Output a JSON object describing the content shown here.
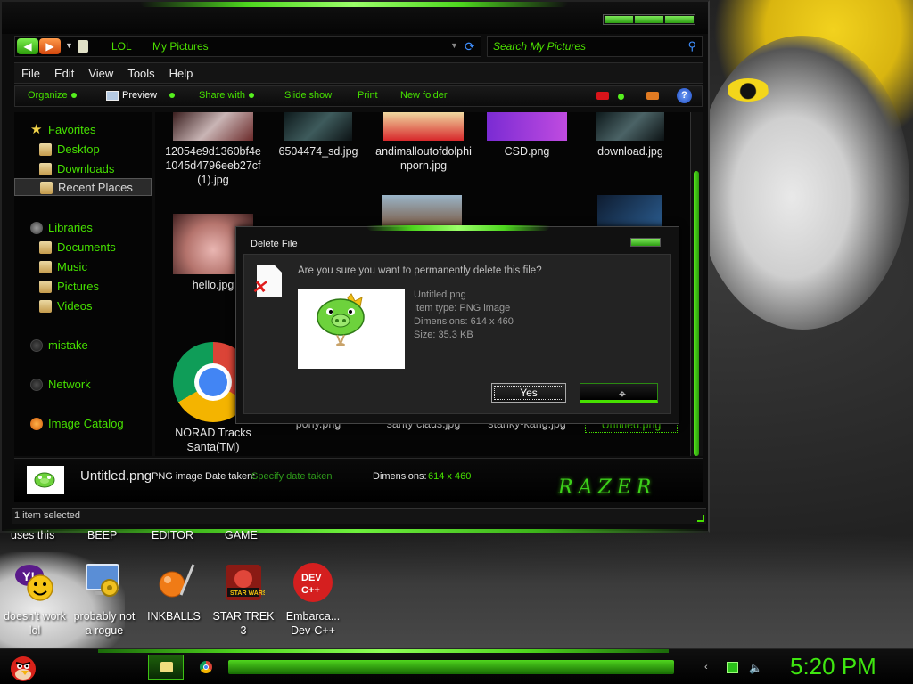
{
  "window": {
    "address": {
      "crumbs": [
        "LOL",
        "My Pictures"
      ]
    },
    "search": {
      "placeholder": "Search My Pictures"
    },
    "menu": [
      "File",
      "Edit",
      "View",
      "Tools",
      "Help"
    ],
    "toolbar": {
      "organize": "Organize",
      "preview": "Preview",
      "share_with": "Share with",
      "slide_show": "Slide show",
      "print": "Print",
      "new_folder": "New folder",
      "help": "?"
    },
    "nav": {
      "favorites": "Favorites",
      "desktop": "Desktop",
      "downloads": "Downloads",
      "recent_places": "Recent Places",
      "libraries": "Libraries",
      "documents": "Documents",
      "music": "Music",
      "pictures": "Pictures",
      "videos": "Videos",
      "mistake": "mistake",
      "network": "Network",
      "image_catalog": "Image Catalog"
    },
    "files": [
      {
        "name": "12054e9d1360bf4e1045d4796eeb27cf (1).jpg"
      },
      {
        "name": "6504474_sd.jpg"
      },
      {
        "name": "andimalloutofdolphinporn.jpg"
      },
      {
        "name": "CSD.png"
      },
      {
        "name": "download.jpg"
      },
      {
        "name": "hello.jpg"
      },
      {
        "name": "NORAD Tracks Santa(TM)"
      },
      {
        "name": "pony.png"
      },
      {
        "name": "santy claus.jpg"
      },
      {
        "name": "stanky-kang.jpg"
      },
      {
        "name": "Untitled.png"
      }
    ],
    "details": {
      "filename": "Untitled.png",
      "filetype": "PNG image",
      "date_label": "Date taken:",
      "date_value": "Specify date taken",
      "dim_label": "Dimensions:",
      "dim_value": "614 x 460",
      "logo": "RAZER"
    },
    "status": "1 item selected"
  },
  "dialog": {
    "title": "Delete File",
    "question": "Are you sure you want to permanently delete this file?",
    "file_name": "Untitled.png",
    "item_type": "Item type: PNG image",
    "dimensions": "Dimensions: 614 x 460",
    "size": "Size: 35.3 KB",
    "yes": "Yes",
    "no": ""
  },
  "desktop": {
    "top_labels": [
      "uses this",
      "BEEP",
      "EDITOR",
      "GAME"
    ],
    "icons": [
      {
        "label": "doesn't work lol",
        "icon": "yahoo-messenger-icon"
      },
      {
        "label": "probably not a rogue",
        "icon": "system-tool-icon"
      },
      {
        "label": "INKBALLS",
        "icon": "inkball-icon"
      },
      {
        "label": "STAR TREK 3",
        "icon": "star-wars-game-icon"
      },
      {
        "label": "Embarca... Dev-C++",
        "icon": "dev-cpp-icon"
      }
    ]
  },
  "taskbar": {
    "clock": "5:20 PM"
  },
  "colors": {
    "accent_green": "#46e000",
    "dark_bg": "#050505",
    "clock_green": "#3fe610"
  }
}
